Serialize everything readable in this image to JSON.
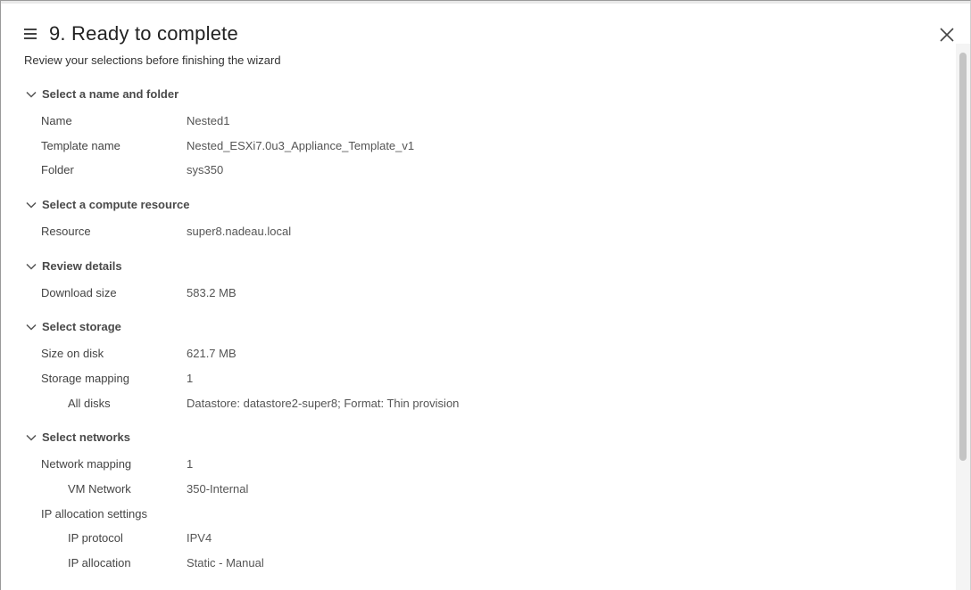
{
  "dialog": {
    "title": "9. Ready to complete",
    "subtitle": "Review your selections before finishing the wizard"
  },
  "sections": [
    {
      "heading": "Select a name and folder",
      "rows": [
        {
          "label": "Name",
          "value": "Nested1"
        },
        {
          "label": "Template name",
          "value": "Nested_ESXi7.0u3_Appliance_Template_v1"
        },
        {
          "label": "Folder",
          "value": "sys350"
        }
      ]
    },
    {
      "heading": "Select a compute resource",
      "rows": [
        {
          "label": "Resource",
          "value": "super8.nadeau.local"
        }
      ]
    },
    {
      "heading": "Review details",
      "rows": [
        {
          "label": "Download size",
          "value": "583.2 MB"
        }
      ]
    },
    {
      "heading": "Select storage",
      "rows": [
        {
          "label": "Size on disk",
          "value": "621.7 MB"
        },
        {
          "label": "Storage mapping",
          "value": "1"
        },
        {
          "label": "All disks",
          "value": "Datastore: datastore2-super8; Format: Thin provision"
        }
      ]
    },
    {
      "heading": "Select networks",
      "rows": [
        {
          "label": "Network mapping",
          "value": "1"
        },
        {
          "label": "VM Network",
          "value": "350-Internal"
        },
        {
          "label": "IP allocation settings",
          "value": ""
        },
        {
          "label": "IP protocol",
          "value": "IPV4"
        },
        {
          "label": "IP allocation",
          "value": "Static - Manual"
        }
      ]
    }
  ],
  "icons": {
    "menu": "hamburger-icon",
    "close": "close-icon",
    "chevron": "chevron-down-icon"
  }
}
